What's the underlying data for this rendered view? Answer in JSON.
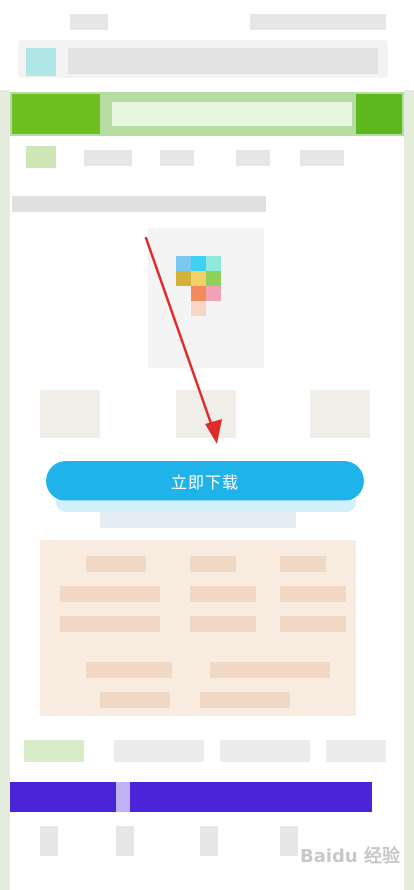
{
  "download_button": {
    "label": "立即下载"
  },
  "watermark": {
    "text": "Baidu 经验"
  },
  "colors": {
    "accent_green": "#6cbf1f",
    "download_blue": "#1fb3ea",
    "banner_purple": "#4a24d9",
    "arrow_red": "#e02b2b"
  }
}
